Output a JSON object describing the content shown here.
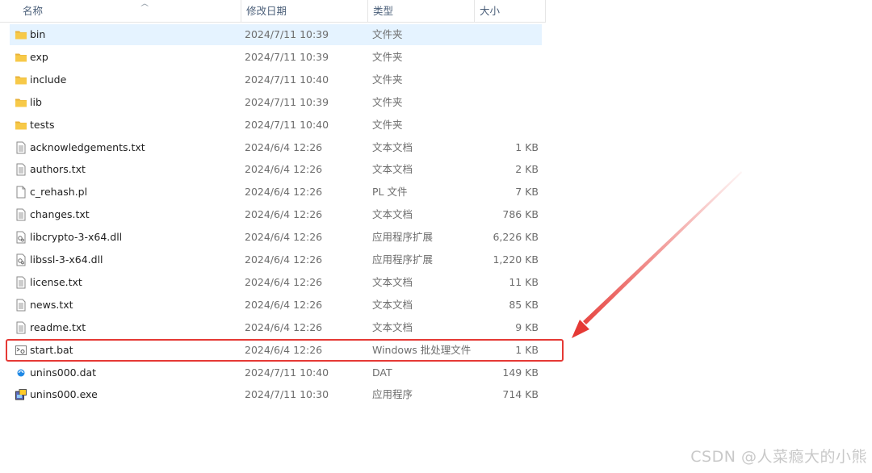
{
  "header": {
    "name": "名称",
    "date": "修改日期",
    "type": "类型",
    "size": "大小"
  },
  "files": [
    {
      "name": "bin",
      "date": "2024/7/11 10:39",
      "type": "文件夹",
      "size": "",
      "icon": "folder-icon",
      "selected": true
    },
    {
      "name": "exp",
      "date": "2024/7/11 10:39",
      "type": "文件夹",
      "size": "",
      "icon": "folder-icon"
    },
    {
      "name": "include",
      "date": "2024/7/11 10:40",
      "type": "文件夹",
      "size": "",
      "icon": "folder-icon"
    },
    {
      "name": "lib",
      "date": "2024/7/11 10:39",
      "type": "文件夹",
      "size": "",
      "icon": "folder-icon"
    },
    {
      "name": "tests",
      "date": "2024/7/11 10:40",
      "type": "文件夹",
      "size": "",
      "icon": "folder-icon"
    },
    {
      "name": "acknowledgements.txt",
      "date": "2024/6/4 12:26",
      "type": "文本文档",
      "size": "1 KB",
      "icon": "text-file-icon"
    },
    {
      "name": "authors.txt",
      "date": "2024/6/4 12:26",
      "type": "文本文档",
      "size": "2 KB",
      "icon": "text-file-icon"
    },
    {
      "name": "c_rehash.pl",
      "date": "2024/6/4 12:26",
      "type": "PL 文件",
      "size": "7 KB",
      "icon": "blank-file-icon"
    },
    {
      "name": "changes.txt",
      "date": "2024/6/4 12:26",
      "type": "文本文档",
      "size": "786 KB",
      "icon": "text-file-icon"
    },
    {
      "name": "libcrypto-3-x64.dll",
      "date": "2024/6/4 12:26",
      "type": "应用程序扩展",
      "size": "6,226 KB",
      "icon": "dll-file-icon"
    },
    {
      "name": "libssl-3-x64.dll",
      "date": "2024/6/4 12:26",
      "type": "应用程序扩展",
      "size": "1,220 KB",
      "icon": "dll-file-icon"
    },
    {
      "name": "license.txt",
      "date": "2024/6/4 12:26",
      "type": "文本文档",
      "size": "11 KB",
      "icon": "text-file-icon"
    },
    {
      "name": "news.txt",
      "date": "2024/6/4 12:26",
      "type": "文本文档",
      "size": "85 KB",
      "icon": "text-file-icon"
    },
    {
      "name": "readme.txt",
      "date": "2024/6/4 12:26",
      "type": "文本文档",
      "size": "9 KB",
      "icon": "text-file-icon"
    },
    {
      "name": "start.bat",
      "date": "2024/6/4 12:26",
      "type": "Windows 批处理文件",
      "size": "1 KB",
      "icon": "batch-file-icon",
      "highlighted": true
    },
    {
      "name": "unins000.dat",
      "date": "2024/7/11 10:40",
      "type": "DAT",
      "size": "149 KB",
      "icon": "dat-file-icon"
    },
    {
      "name": "unins000.exe",
      "date": "2024/7/11 10:30",
      "type": "应用程序",
      "size": "714 KB",
      "icon": "exe-file-icon"
    }
  ],
  "colors": {
    "highlight": "#e53935",
    "selected_row": "#e5f3ff",
    "folder": "#f7c948"
  },
  "watermark": "CSDN @人菜瘾大的小熊"
}
